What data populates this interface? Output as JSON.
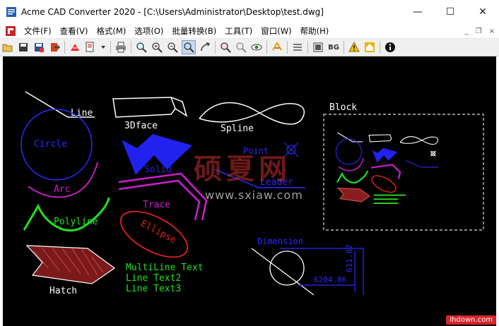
{
  "window": {
    "title": "Acme CAD Converter 2020 - [C:\\Users\\Administrator\\Desktop\\test.dwg]",
    "minimize_glyph": "—",
    "maximize_glyph": "☐",
    "close_glyph": "✕"
  },
  "menu": {
    "items": [
      "文件(F)",
      "查看(V)",
      "格式(M)",
      "选项(O)",
      "批量转换(B)",
      "工具(T)",
      "窗口(W)",
      "帮助(H)"
    ],
    "mdi_minimize": "_",
    "mdi_restore": "❐",
    "mdi_close": "×"
  },
  "toolbar": {
    "bg_label": "BG",
    "icons": [
      "open-icon",
      "save-icon",
      "save-as-icon",
      "export-icon",
      "convert-icon",
      "print-preview-icon",
      "dropdown-icon",
      "print-icon",
      "zoom-window-icon",
      "zoom-in-icon",
      "zoom-out-icon",
      "zoom-realtime-icon",
      "pan-icon",
      "zoom-previous-icon",
      "view-icon",
      "layer-icon",
      "measure-icon",
      "page-icon",
      "background-icon",
      "warning-icon",
      "home-icon",
      "info-icon"
    ]
  },
  "drawing": {
    "labels": {
      "line": "Line",
      "face3d": "3Dface",
      "spline": "Spline",
      "circle": "Circle",
      "solid": "Solid",
      "arc": "Arc",
      "point": "Point",
      "leader": "Leader",
      "polyline": "Polyline",
      "trace": "Trace",
      "ellipse": "Ellipse",
      "hatch": "Hatch",
      "multiline_1": "MultiLine Text",
      "multiline_2": "Line Text2",
      "multiline_3": "Line Text3",
      "dimension": "Dimension",
      "dim_value_1": "6204.86",
      "dim_value_2": "611.87",
      "block": "Block"
    },
    "colors": {
      "white": "#ffffff",
      "blue": "#2a2aff",
      "magenta": "#d01cd0",
      "green": "#22e022",
      "red": "#e02020"
    }
  },
  "watermark": {
    "text": "硕夏网",
    "url": "www.sxiaw.com"
  },
  "badge": {
    "text": "lhdown.com"
  }
}
